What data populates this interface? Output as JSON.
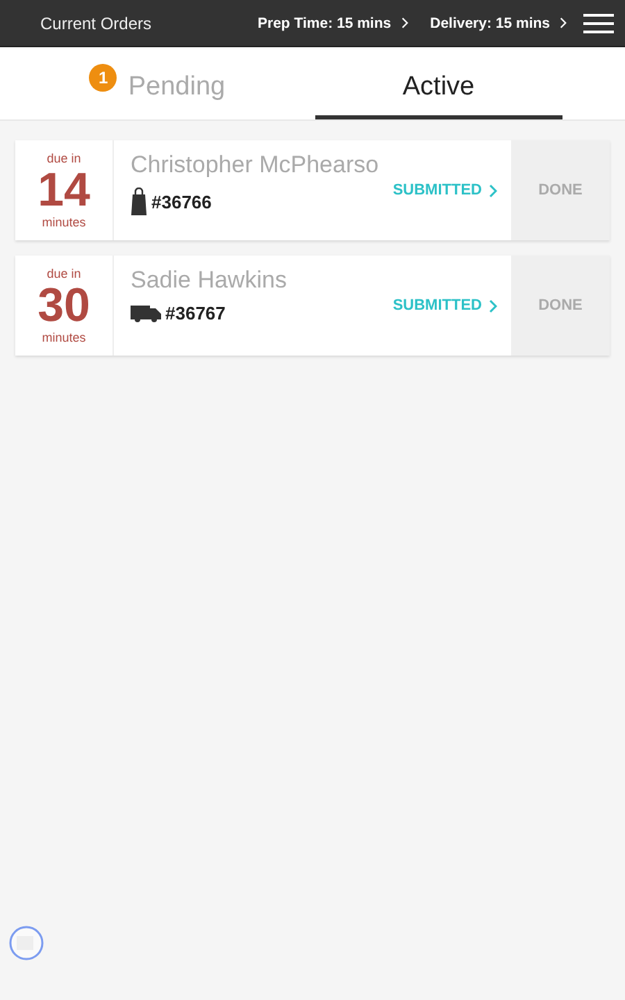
{
  "header": {
    "title": "Current Orders",
    "prep_time": "Prep Time: 15 mins",
    "delivery": "Delivery: 15 mins"
  },
  "tabs": [
    {
      "label": "Pending",
      "badge": "1",
      "selected": false
    },
    {
      "label": "Active",
      "selected": true
    }
  ],
  "orders": [
    {
      "due_label": "due in",
      "minutes": "14",
      "unit": "minutes",
      "name": "Christopher McPhearso",
      "kind": "bag",
      "number": "#36766",
      "status": "SUBMITTED",
      "action": "DONE"
    },
    {
      "due_label": "due in",
      "minutes": "30",
      "unit": "minutes",
      "name": "Sadie Hawkins",
      "kind": "van",
      "number": "#36767",
      "status": "SUBMITTED",
      "action": "DONE"
    }
  ]
}
